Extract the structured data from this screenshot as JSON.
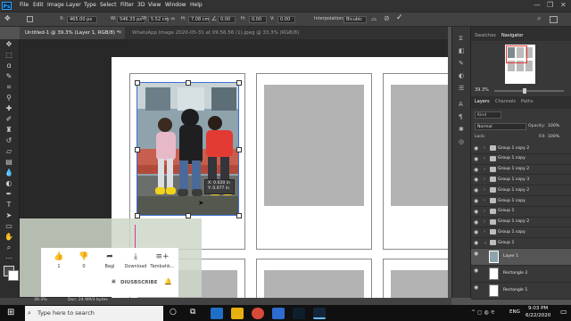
{
  "menubar": {
    "items": [
      "File",
      "Edit",
      "Image",
      "Layer",
      "Type",
      "Select",
      "Filter",
      "3D",
      "View",
      "Window",
      "Help"
    ]
  },
  "options": {
    "x_label": "X:",
    "x_value": "465.00 px",
    "w_label": "W:",
    "w_value": "546.33 px",
    "w_pct_label": "W:",
    "w_pct": "5.52 cm",
    "angle_value": "0.00",
    "h_label": "H:",
    "h_value": "7.08 cm",
    "v_value": "0.00",
    "interp_label": "Interpolation:",
    "interp_value": "Bicubic"
  },
  "tabs": [
    {
      "label": "Untitled-1 @ 39.3% (Layer 1, RGB/8) *",
      "active": true
    },
    {
      "label": "WhatsApp Image 2020-05-31 at 09.56.56 (1).jpeg @ 33.3% (RGB/8)",
      "active": false
    }
  ],
  "tooltip": {
    "line1": "X: 0.020 in",
    "line2": "Y: 0.077 in"
  },
  "youtube": {
    "like_count": "1",
    "dislike_count": "0",
    "share_label": "Bagi",
    "download_label": "Download",
    "save_label": "Tambahk...",
    "unsubscribe_label": "DIUSBSCRIBE"
  },
  "panels": {
    "tab_swatches": "Swatches",
    "tab_navigator": "Navigator",
    "nav_zoom": "39.3%",
    "tab_layers": "Layers",
    "tab_channels": "Channels",
    "tab_paths": "Paths",
    "kind_placeholder": "Kind",
    "blend_mode": "Normal",
    "opacity_label": "Opacity:",
    "opacity_value": "100%",
    "lock_label": "Lock:",
    "fill_label": "Fill:",
    "fill_value": "100%"
  },
  "layers": [
    {
      "name": "Group 1 copy 2",
      "type": "group"
    },
    {
      "name": "Group 1 copy",
      "type": "group"
    },
    {
      "name": "Group 1 copy 2",
      "type": "group"
    },
    {
      "name": "Group 1 copy 3",
      "type": "group"
    },
    {
      "name": "Group 1 copy 2",
      "type": "group"
    },
    {
      "name": "Group 1 copy",
      "type": "group"
    },
    {
      "name": "Group 1",
      "type": "group"
    },
    {
      "name": "Group 1 copy 2",
      "type": "group"
    },
    {
      "name": "Group 1 copy",
      "type": "group"
    },
    {
      "name": "Group 1",
      "type": "group-open"
    },
    {
      "name": "Layer 1",
      "type": "image",
      "selected": true
    },
    {
      "name": "Rectangle 2",
      "type": "shape"
    },
    {
      "name": "Rectangle 1",
      "type": "shape"
    }
  ],
  "status": {
    "zoom": "39.3%",
    "doc": "Doc: 24.9M/3 bytes"
  },
  "taskbar": {
    "search_placeholder": "Type here to search",
    "time": "9:03 PM",
    "date": "6/22/2020",
    "lang": "ENG"
  }
}
